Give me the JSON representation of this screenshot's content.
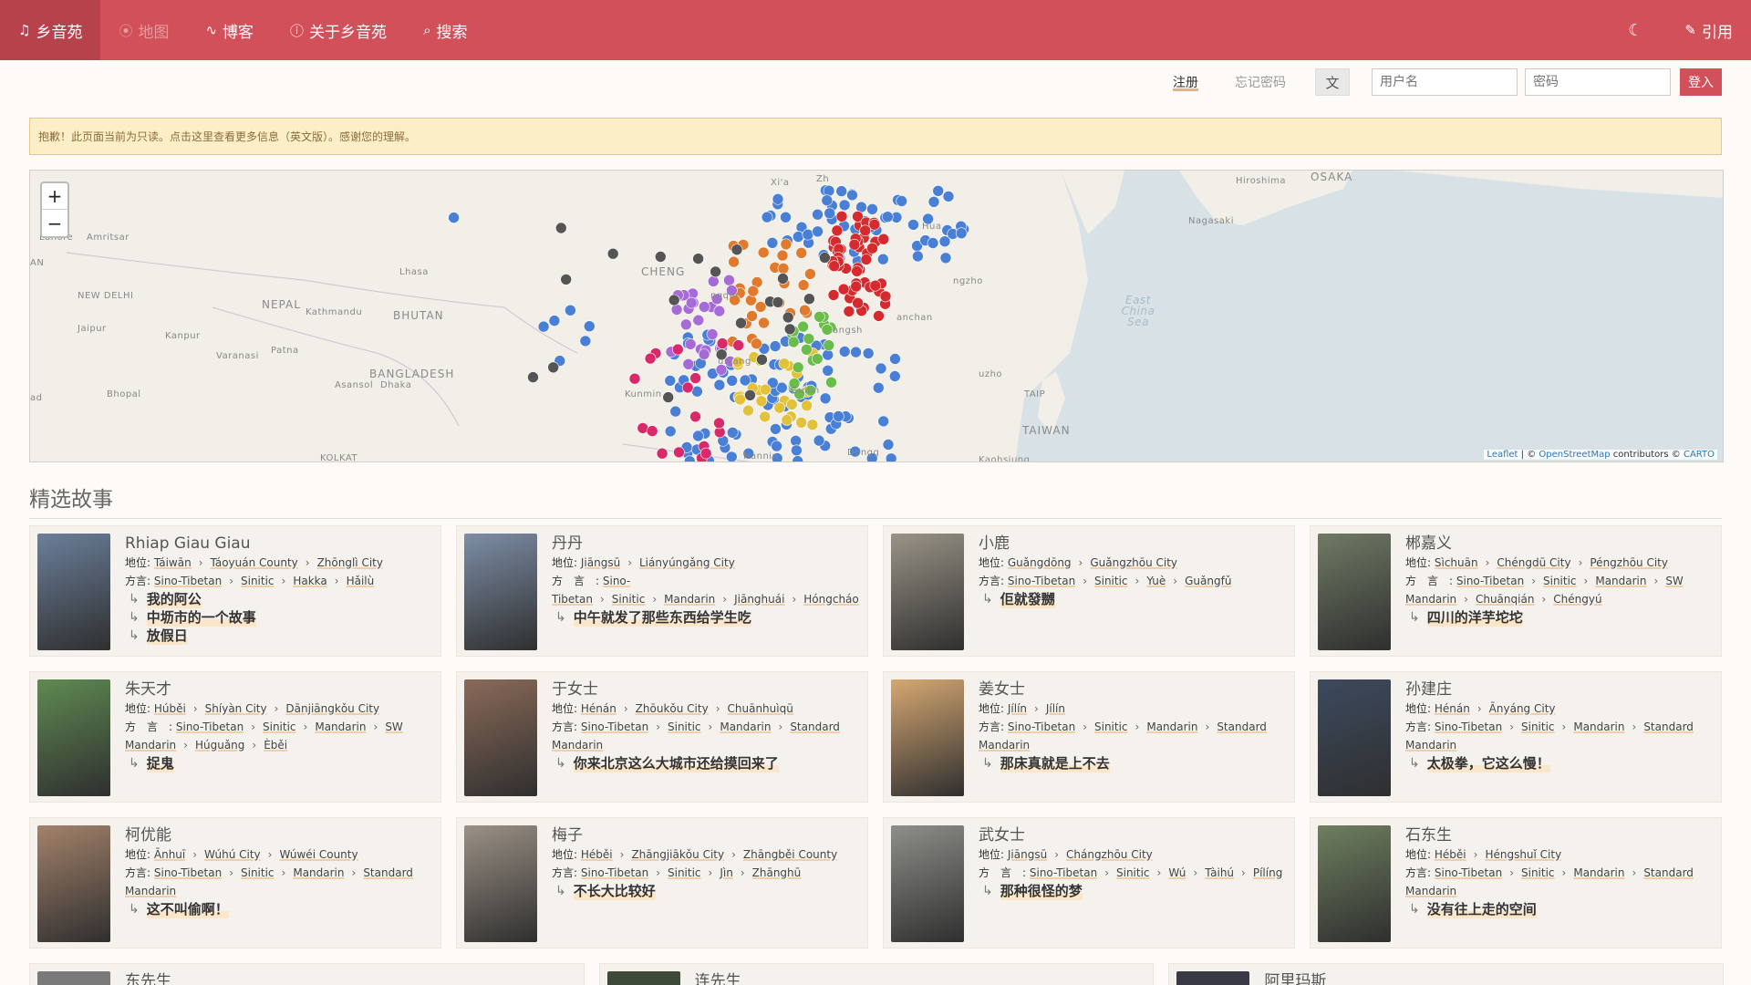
{
  "nav": {
    "brand": "乡音苑",
    "map": "地图",
    "blog": "博客",
    "about": "关于乡音苑",
    "search": "搜索",
    "cite": "引用"
  },
  "login": {
    "register": "注册",
    "forgot": "忘记密码",
    "username_placeholder": "用户名",
    "password_placeholder": "密码",
    "submit": "登入"
  },
  "alert": "抱歉！此页面当前为只读。点击这里查看更多信息（英文版）。感谢您的理解。",
  "map": {
    "zoom_in": "+",
    "zoom_out": "−",
    "attribution_leaflet": "Leaflet",
    "attribution_osm": "OpenStreetMap",
    "attribution_contrib": "contributors ©",
    "attribution_carto": "CARTO",
    "labels": {
      "china": "CHENG",
      "nepal": "NEPAL",
      "bhutan": "BHUTAN",
      "bangladesh": "BANGLADESH",
      "new_delhi": "NEW DELHI",
      "lahore": "Lahore",
      "amritsar": "Amritsar",
      "jaipur": "Jaipur",
      "kanpur": "Kanpur",
      "lhasa": "Lhasa",
      "kathmandu": "Kathmandu",
      "patna": "Patna",
      "varanasi": "Varanasi",
      "asansol": "Asansol",
      "dhaka": "Dhaka",
      "bhopal": "Bhopal",
      "kolkata": "KOLKAT",
      "hiroshima": "Hiroshima",
      "osaka": "OSAKA",
      "nagasaki": "Nagasaki",
      "east_china_sea": "East China Sea",
      "taiwan": "TAIWAN",
      "nanning": "Nannin",
      "kunming": "Kunmin",
      "an": "AN",
      "xian": "Xi'a",
      "hua": "Hua",
      "anch": "anchan",
      "guilin": "Guilin",
      "guiyang": "uiyang",
      "chongqing": "ngqin",
      "changsha": "angsh",
      "fuzhou": "uzho",
      "tai": "TAIP",
      "dong": "Dongg",
      "kaoh": "Kaohsiung",
      "zhen": "ngzho",
      "bad": "ad",
      "zh": "Zh"
    }
  },
  "section_title": "精选故事",
  "stories": [
    {
      "name": "Rhiap Giau Giau",
      "loc_label": "地位:",
      "loc": [
        "Táiwān",
        "Táoyuán County",
        "Zhōnglì City"
      ],
      "dia_label": "方言:",
      "dia": [
        "Sino-Tibetan",
        "Sinitic",
        "Hakka",
        "Hǎilù"
      ],
      "titles": [
        "我的阿公",
        "中坜市的一个故事",
        "放假日"
      ],
      "photo": "#6b7f9a"
    },
    {
      "name": "丹丹",
      "loc_label": "地位:",
      "loc": [
        "Jiāngsū",
        "Liányúngǎng City"
      ],
      "dia_label": "方　言　:",
      "dia": [
        "Sino-Tibetan",
        "Sinitic",
        "Mandarin",
        "Jiānghuái",
        "Hóngcháo"
      ],
      "titles": [
        "中午就发了那些东西给学生吃"
      ],
      "photo": "#7d8ea6"
    },
    {
      "name": "小鹿",
      "loc_label": "地位:",
      "loc": [
        "Guǎngdōng",
        "Guǎngzhōu City"
      ],
      "dia_label": "方言:",
      "dia": [
        "Sino-Tibetan",
        "Sinitic",
        "Yuè",
        "Guǎngfǔ"
      ],
      "titles": [
        "佢就發嬲"
      ],
      "photo": "#9a9487"
    },
    {
      "name": "郴嘉义",
      "loc_label": "地位:",
      "loc": [
        "Sìchuān",
        "Chéngdū City",
        "Péngzhōu City"
      ],
      "dia_label": "方　言　:",
      "dia": [
        "Sino-Tibetan",
        "Sinitic",
        "Mandarin",
        "SW Mandarin",
        "Chuānqián",
        "Chéngyú"
      ],
      "titles": [
        "四川的洋芋坨坨"
      ],
      "photo": "#6f7a64"
    },
    {
      "name": "朱天才",
      "loc_label": "地位:",
      "loc": [
        "Húběi",
        "Shíyàn City",
        "Dānjiāngkǒu City"
      ],
      "dia_label": "方　言　:",
      "dia": [
        "Sino-Tibetan",
        "Sinitic",
        "Mandarin",
        "SW Mandarin",
        "Húguǎng",
        "Èběi"
      ],
      "titles": [
        "捉鬼"
      ],
      "photo": "#5f8a52"
    },
    {
      "name": "于女士",
      "loc_label": "地位:",
      "loc": [
        "Hénán",
        "Zhōukǒu City",
        "Chuānhuìqū"
      ],
      "dia_label": "方言:",
      "dia": [
        "Sino-Tibetan",
        "Sinitic",
        "Mandarin",
        "Standard Mandarin"
      ],
      "titles": [
        "你来北京这么大城市还给摸回来了"
      ],
      "photo": "#8a6a58"
    },
    {
      "name": "姜女士",
      "loc_label": "地位:",
      "loc": [
        "Jílín",
        "Jílín"
      ],
      "dia_label": "方言:",
      "dia": [
        "Sino-Tibetan",
        "Sinitic",
        "Mandarin",
        "Standard Mandarin"
      ],
      "titles": [
        "那床真就是上不去"
      ],
      "photo": "#d6a872"
    },
    {
      "name": "孙建庄",
      "loc_label": "地位:",
      "loc": [
        "Hénán",
        "Ānyáng City"
      ],
      "dia_label": "方言:",
      "dia": [
        "Sino-Tibetan",
        "Sinitic",
        "Mandarin",
        "Standard Mandarin"
      ],
      "titles": [
        "太极拳，它这么慢！"
      ],
      "photo": "#3c4a5e"
    },
    {
      "name": "柯优能",
      "loc_label": "地位:",
      "loc": [
        "Ānhuī",
        "Wúhú City",
        "Wúwéi County"
      ],
      "dia_label": "方言:",
      "dia": [
        "Sino-Tibetan",
        "Sinitic",
        "Mandarin",
        "Standard Mandarin"
      ],
      "titles": [
        "这不叫偷啊！"
      ],
      "photo": "#a3826a"
    },
    {
      "name": "梅子",
      "loc_label": "地位:",
      "loc": [
        "Héběi",
        "Zhāngjiākǒu City",
        "Zhāngběi County"
      ],
      "dia_label": "方言:",
      "dia": [
        "Sino-Tibetan",
        "Sinitic",
        "Jìn",
        "Zhānghū"
      ],
      "titles": [
        "不长大比较好"
      ],
      "photo": "#9b9185"
    },
    {
      "name": "武女士",
      "loc_label": "地位:",
      "loc": [
        "Jiāngsū",
        "Chángzhōu City"
      ],
      "dia_label": "方　言　:",
      "dia": [
        "Sino-Tibetan",
        "Sinitic",
        "Wú",
        "Tàihú",
        "Pílíng"
      ],
      "titles": [
        "那种很怪的梦"
      ],
      "photo": "#8e8e8a"
    },
    {
      "name": "石东生",
      "loc_label": "地位:",
      "loc": [
        "Héběi",
        "Héngshuǐ City"
      ],
      "dia_label": "方言:",
      "dia": [
        "Sino-Tibetan",
        "Sinitic",
        "Mandarin",
        "Standard Mandarin"
      ],
      "titles": [
        "没有往上走的空间"
      ],
      "photo": "#6e7f5f"
    }
  ],
  "stories_bottom": [
    {
      "name": "东先生",
      "photo": "#7a7a7a"
    },
    {
      "name": "连先生",
      "photo": "#3d4a3a"
    },
    {
      "name": "阿里玛斯",
      "photo": "#3a3a46"
    }
  ],
  "map_dots": {
    "colors": {
      "mandarin": "#4a7fd6",
      "wu": "#d52b2e",
      "gan": "#e07a2c",
      "xiang": "#a66bd6",
      "yue": "#e2c23b",
      "hakka": "#6abd4b",
      "min": "#d82a6a",
      "other": "#555555"
    }
  }
}
